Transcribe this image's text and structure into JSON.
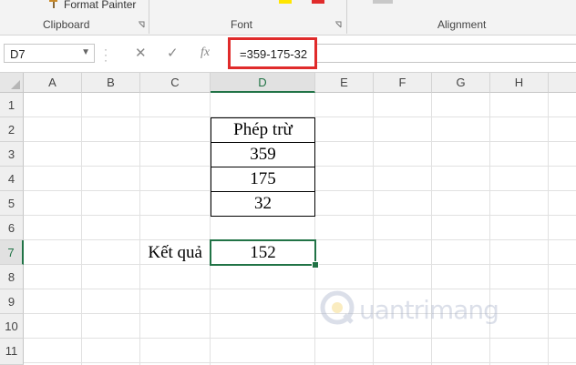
{
  "ribbon": {
    "format_painter_label": "Format Painter",
    "groups": [
      "Clipboard",
      "Font",
      "Alignment"
    ],
    "font_color": "#e02b2b",
    "highlight_color": "#ffe600"
  },
  "formula_bar": {
    "name_box": "D7",
    "fx_label": "fx",
    "formula": "=359-175-32"
  },
  "sheet": {
    "columns": [
      "A",
      "B",
      "C",
      "D",
      "E",
      "F",
      "G",
      "H"
    ],
    "rows": [
      "1",
      "2",
      "3",
      "4",
      "5",
      "6",
      "7",
      "8",
      "9",
      "10",
      "11"
    ],
    "selected_column": "D",
    "selected_row": "7",
    "cells": {
      "D2": "Phép trừ",
      "D3": "359",
      "D4": "175",
      "D5": "32",
      "C7": "Kết quả",
      "D7": "152"
    }
  },
  "watermark": {
    "text": "uantrimang"
  },
  "colors": {
    "accent": "#217346",
    "highlight_box": "#e02b2b"
  }
}
